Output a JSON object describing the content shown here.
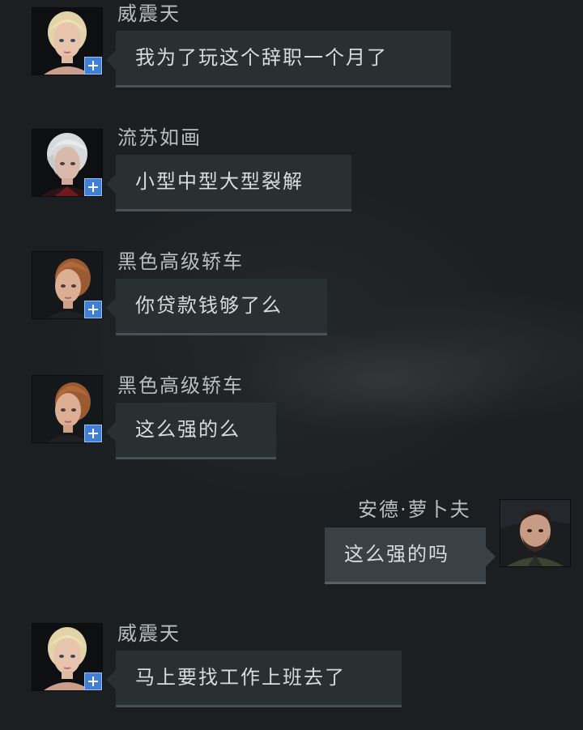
{
  "messages": [
    {
      "sender": "威震天",
      "text": "我为了玩这个辞职一个月了",
      "side": "left",
      "portrait": "blonde-female-portrait"
    },
    {
      "sender": "流苏如画",
      "text": "小型中型大型裂解",
      "side": "left",
      "portrait": "silver-hair-female-portrait"
    },
    {
      "sender": "黑色高级轿车",
      "text": "你贷款钱够了么",
      "side": "left",
      "portrait": "auburn-female-portrait"
    },
    {
      "sender": "黑色高级轿车",
      "text": "这么强的么",
      "side": "left",
      "portrait": "auburn-female-portrait"
    },
    {
      "sender": "安德·萝卜夫",
      "text": "这么强的吗",
      "side": "right",
      "portrait": "bearded-male-portrait"
    },
    {
      "sender": "威震天",
      "text": "马上要找工作上班去了",
      "side": "left",
      "portrait": "blonde-female-portrait"
    }
  ],
  "icons": {
    "add_contact": "plus-icon"
  },
  "colors": {
    "background": "#1c1f21",
    "bubble": "#2a2f32",
    "bubble_own": "#3a4043",
    "sender_text": "#b9bec1",
    "message_text": "#d9dcde",
    "add_badge": "#3f7fd6"
  }
}
